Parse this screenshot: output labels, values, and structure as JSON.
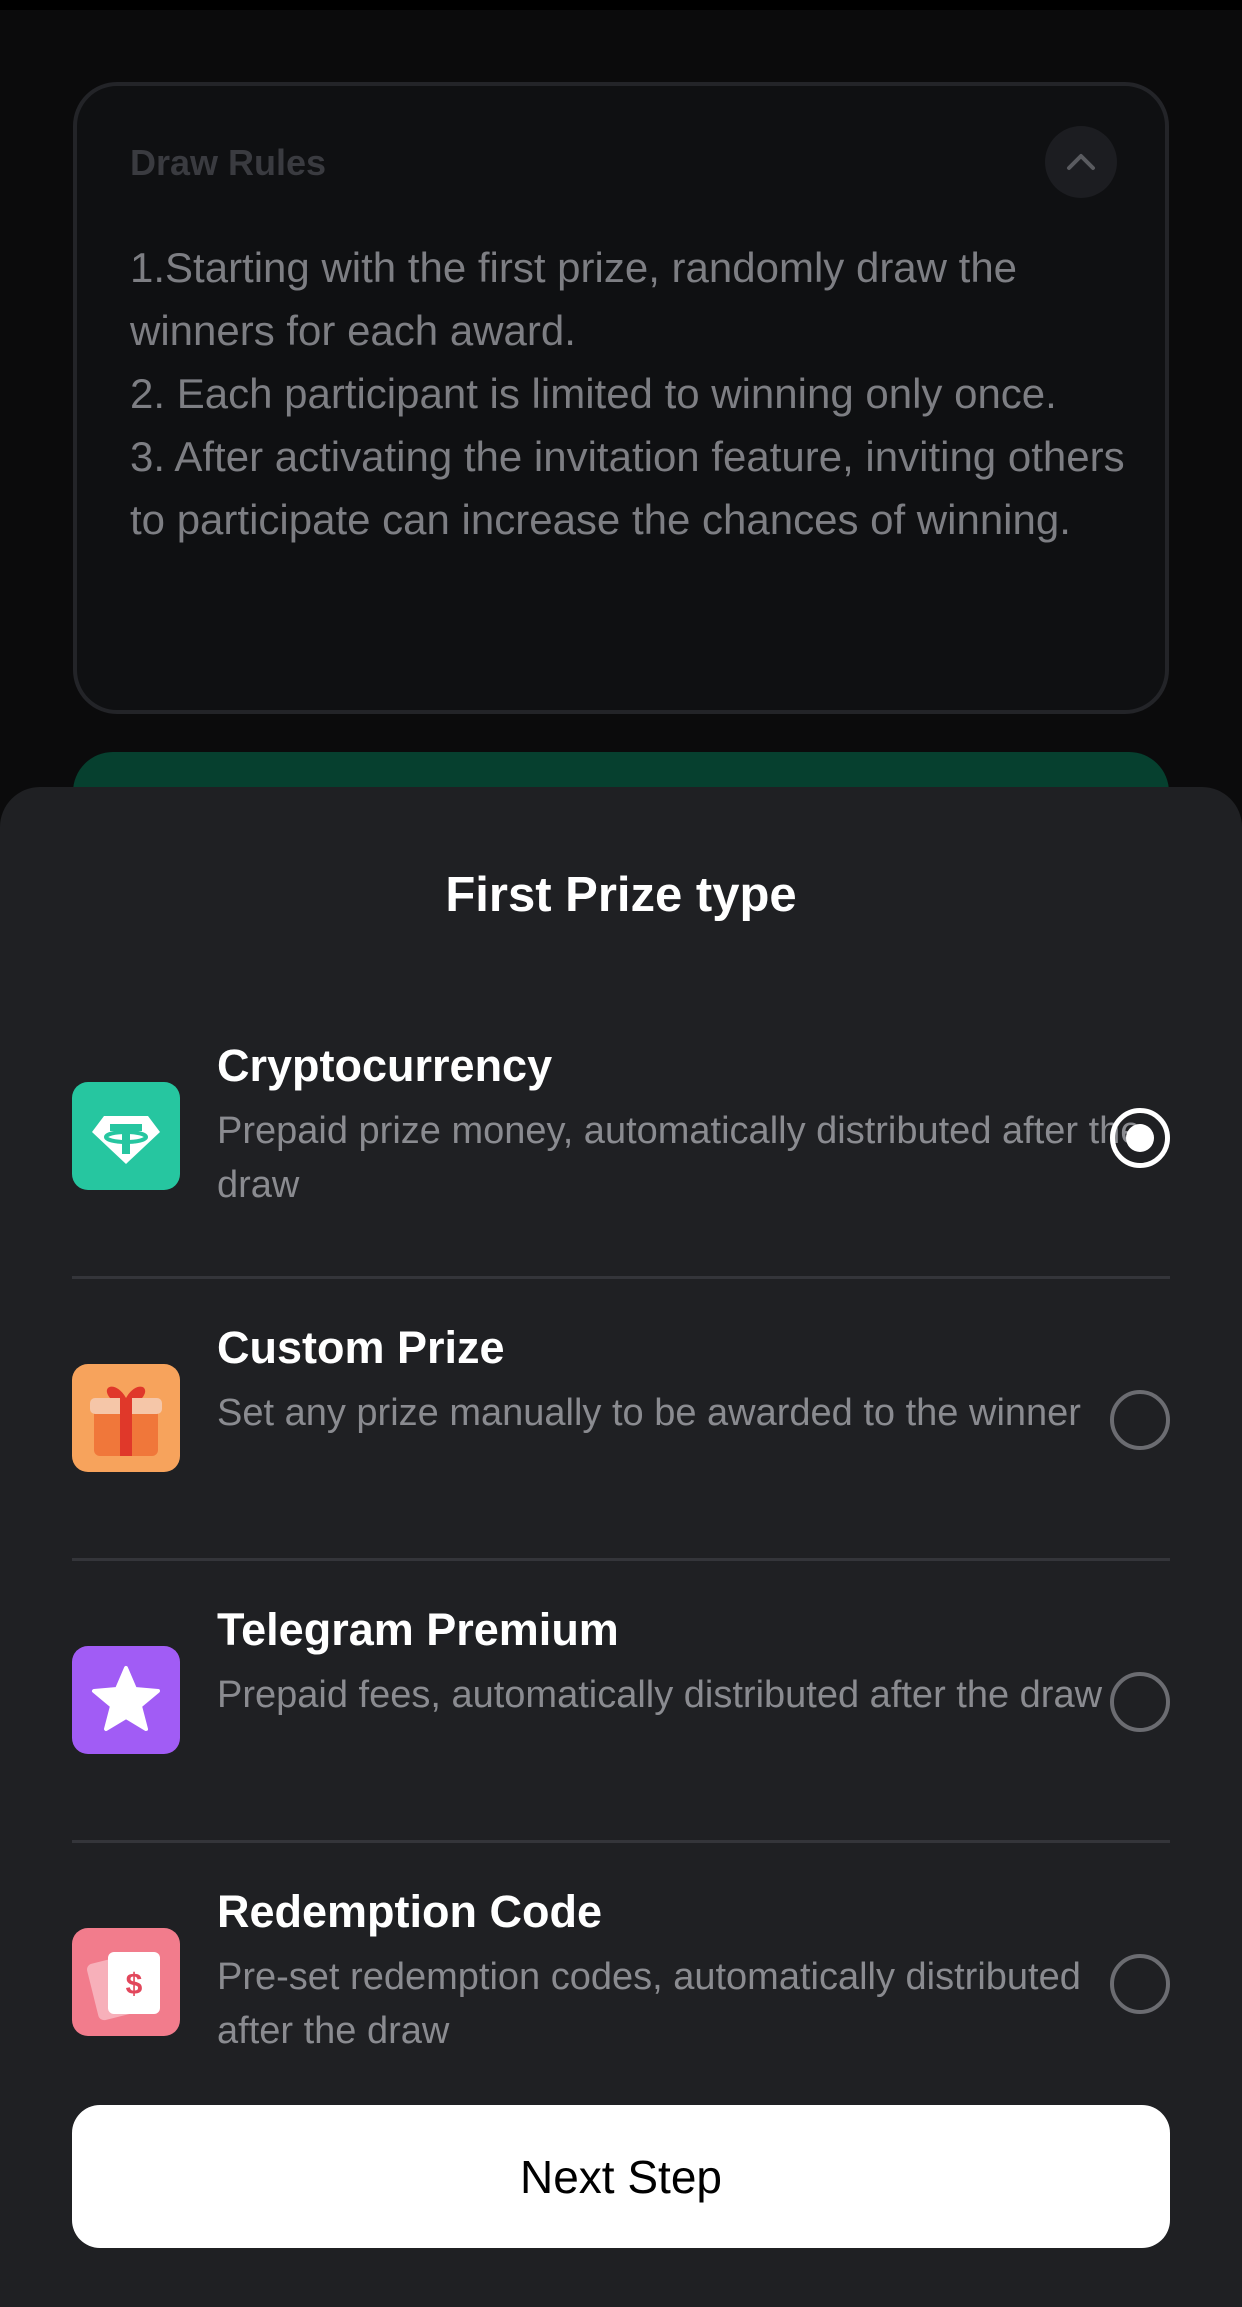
{
  "background": {
    "rules": {
      "title": "Draw Rules",
      "lines": [
        "1.Starting with the first prize, randomly draw the winners for each award.",
        "2. Each participant is limited to winning only once.",
        "3. After activating the invitation feature, inviting others to participate can increase the chances of winning."
      ],
      "toggle_icon": "chevron-up-icon"
    }
  },
  "sheet": {
    "title": "First Prize type",
    "options": [
      {
        "title": "Cryptocurrency",
        "description": "Prepaid prize money, automatically distributed after the draw",
        "icon": "tether-icon",
        "icon_color": "#26c6a0",
        "selected": true
      },
      {
        "title": "Custom Prize",
        "description": "Set any prize manually to be awarded to the winner",
        "icon": "gift-icon",
        "icon_color": "#f7a35c",
        "selected": false
      },
      {
        "title": "Telegram Premium",
        "description": "Prepaid fees, automatically distributed after the draw",
        "icon": "star-icon",
        "icon_color": "#a15cf5",
        "selected": false
      },
      {
        "title": "Redemption Code",
        "description": "Pre-set redemption codes, automatically distributed after the draw",
        "icon": "redemption-ticket-icon",
        "icon_color": "#f27c8c",
        "selected": false
      }
    ],
    "next_button_label": "Next Step"
  }
}
